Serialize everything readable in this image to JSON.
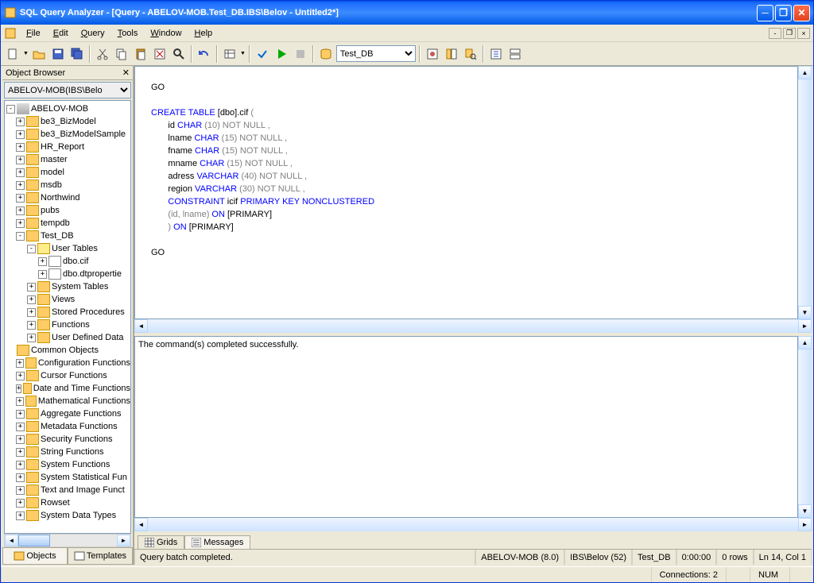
{
  "title": "SQL Query Analyzer - [Query - ABELOV-MOB.Test_DB.IBS\\Belov - Untitled2*]",
  "menu": {
    "file": "File",
    "edit": "Edit",
    "query": "Query",
    "tools": "Tools",
    "window": "Window",
    "help": "Help"
  },
  "toolbar": {
    "db_selected": "Test_DB"
  },
  "sidebar": {
    "title": "Object Browser",
    "combo": "ABELOV-MOB(IBS\\Belo",
    "server": "ABELOV-MOB",
    "databases": [
      "be3_BizModel",
      "be3_BizModelSample",
      "HR_Report",
      "master",
      "model",
      "msdb",
      "Northwind",
      "pubs",
      "tempdb"
    ],
    "selected_db": "Test_DB",
    "user_tables": "User Tables",
    "ut_items": [
      "dbo.cif",
      "dbo.dtpropertie"
    ],
    "folders": [
      "System Tables",
      "Views",
      "Stored Procedures",
      "Functions",
      "User Defined Data"
    ],
    "common": "Common Objects",
    "common_items": [
      "Configuration Functions",
      "Cursor Functions",
      "Date and Time Functions",
      "Mathematical Functions",
      "Aggregate Functions",
      "Metadata Functions",
      "Security Functions",
      "String Functions",
      "System Functions",
      "System Statistical Fun",
      "Text and Image Funct",
      "Rowset",
      "System Data Types"
    ],
    "tabs": {
      "objects": "Objects",
      "templates": "Templates"
    }
  },
  "sql": {
    "line1": "GO",
    "kw_create": "CREATE",
    "kw_table": "TABLE",
    "t_name": " [dbo].cif ",
    "p_open": "(",
    "f_id": "id ",
    "kw_char": "CHAR",
    "n10": "(10)",
    "not_null": " NOT NULL ",
    "comma": ",",
    "f_lname": "lname ",
    "n15": "(15)",
    "f_fname": "fname ",
    "f_mname": "mname ",
    "f_adress": "adress ",
    "kw_varchar": "VARCHAR",
    "n40": "(40)",
    "f_region": "region ",
    "n30": "(30)",
    "kw_constraint": "CONSTRAINT",
    "c_name": " icif ",
    "kw_pk": "PRIMARY",
    "kw_key": " KEY ",
    "kw_nc": "NONCLUSTERED",
    "p_list": "(id, lname)",
    "kw_on": " ON ",
    "primary": "[PRIMARY]",
    "p_close": ")",
    "go2": "GO"
  },
  "results": {
    "message": "The command(s) completed successfully."
  },
  "result_tabs": {
    "grids": "Grids",
    "messages": "Messages"
  },
  "status": {
    "msg": "Query batch completed.",
    "server": "ABELOV-MOB (8.0)",
    "user": "IBS\\Belov (52)",
    "db": "Test_DB",
    "time": "0:00:00",
    "rows": "0 rows",
    "pos": "Ln 14, Col 1"
  },
  "status2": {
    "conn": "Connections: 2",
    "num": "NUM"
  }
}
